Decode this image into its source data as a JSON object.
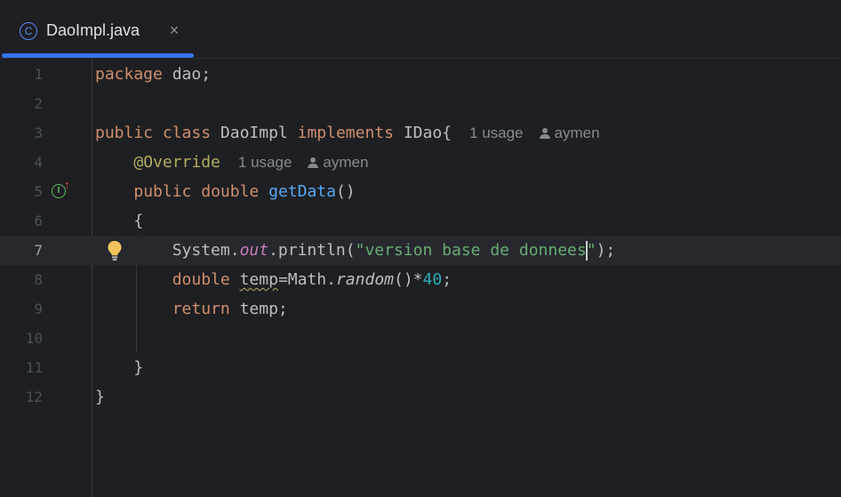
{
  "tab": {
    "icon": "java-class-icon",
    "icon_glyph": "C",
    "label": "DaoImpl.java",
    "close_glyph": "×"
  },
  "colors": {
    "accent": "#3574f0",
    "keyword": "#cf8e6d",
    "function": "#56a8f5",
    "string": "#6aab73",
    "number": "#2aacb8",
    "annotation": "#b3ae60",
    "static_field": "#c77dbb"
  },
  "editor": {
    "current_line": 7,
    "lines": [
      {
        "n": "1",
        "tokens": [
          "package",
          " dao;"
        ]
      },
      {
        "n": "2",
        "tokens": []
      },
      {
        "n": "3",
        "tokens": [
          "public",
          " ",
          "class",
          " DaoImpl ",
          "implements",
          " IDao{"
        ],
        "hint_usage": "1 usage",
        "hint_author": "aymen"
      },
      {
        "n": "4",
        "tokens": [
          "    ",
          "@Override"
        ],
        "hint_usage": "1 usage",
        "hint_author": "aymen"
      },
      {
        "n": "5",
        "tokens": [
          "    ",
          "public",
          " ",
          "double",
          " ",
          "getData",
          "()"
        ],
        "gutter_icon": "implements-method-icon",
        "gutter_glyph": "I",
        "gutter_arrow": "↑"
      },
      {
        "n": "6",
        "tokens": [
          "    {"
        ]
      },
      {
        "n": "7",
        "tokens": [
          "        System.",
          "out",
          ".println(",
          "\"version base de donnees",
          "\"",
          ");"
        ],
        "gutter_icon": "lightbulb-icon"
      },
      {
        "n": "8",
        "tokens": [
          "        ",
          "double",
          " ",
          "temp",
          "=Math.",
          "random",
          "()*",
          "40",
          ";"
        ]
      },
      {
        "n": "9",
        "tokens": [
          "        ",
          "return",
          " temp;"
        ]
      },
      {
        "n": "10",
        "tokens": []
      },
      {
        "n": "11",
        "tokens": [
          "    }"
        ]
      },
      {
        "n": "12",
        "tokens": [
          "}"
        ]
      }
    ]
  }
}
